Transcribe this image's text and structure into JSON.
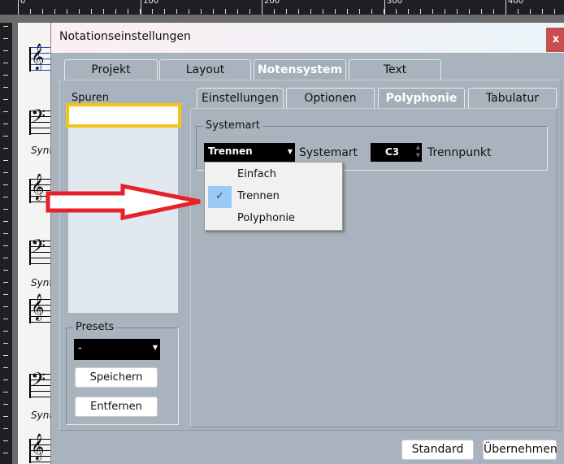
{
  "ruler": {
    "labels": [
      "0",
      "100",
      "200",
      "300",
      "400"
    ]
  },
  "score": {
    "track_label": "Synt"
  },
  "dialog": {
    "title": "Notationseinstellungen",
    "close_label": "x",
    "tabs": [
      {
        "label": "Projekt"
      },
      {
        "label": "Layout"
      },
      {
        "label": "Notensystem",
        "selected": true
      },
      {
        "label": "Text"
      }
    ],
    "spuren": {
      "label": "Spuren"
    },
    "subtabs": [
      {
        "label": "Einstellungen"
      },
      {
        "label": "Optionen"
      },
      {
        "label": "Polyphonie",
        "selected": true
      },
      {
        "label": "Tabulatur"
      }
    ],
    "systemart": {
      "group_label": "Systemart",
      "dropdown_value": "Trennen",
      "dropdown_label": "Systemart",
      "split_value": "C3",
      "split_label": "Trennpunkt",
      "options": [
        {
          "label": "Einfach"
        },
        {
          "label": "Trennen",
          "checked": true
        },
        {
          "label": "Polyphonie"
        }
      ]
    },
    "presets": {
      "group_label": "Presets",
      "value": "-",
      "save_label": "Speichern",
      "remove_label": "Entfernen"
    },
    "footer": {
      "standard_label": "Standard",
      "apply_label": "Übernehmen"
    }
  },
  "annotations": {
    "highlight_color": "#f5c518",
    "arrow_color": "#e8202a"
  }
}
